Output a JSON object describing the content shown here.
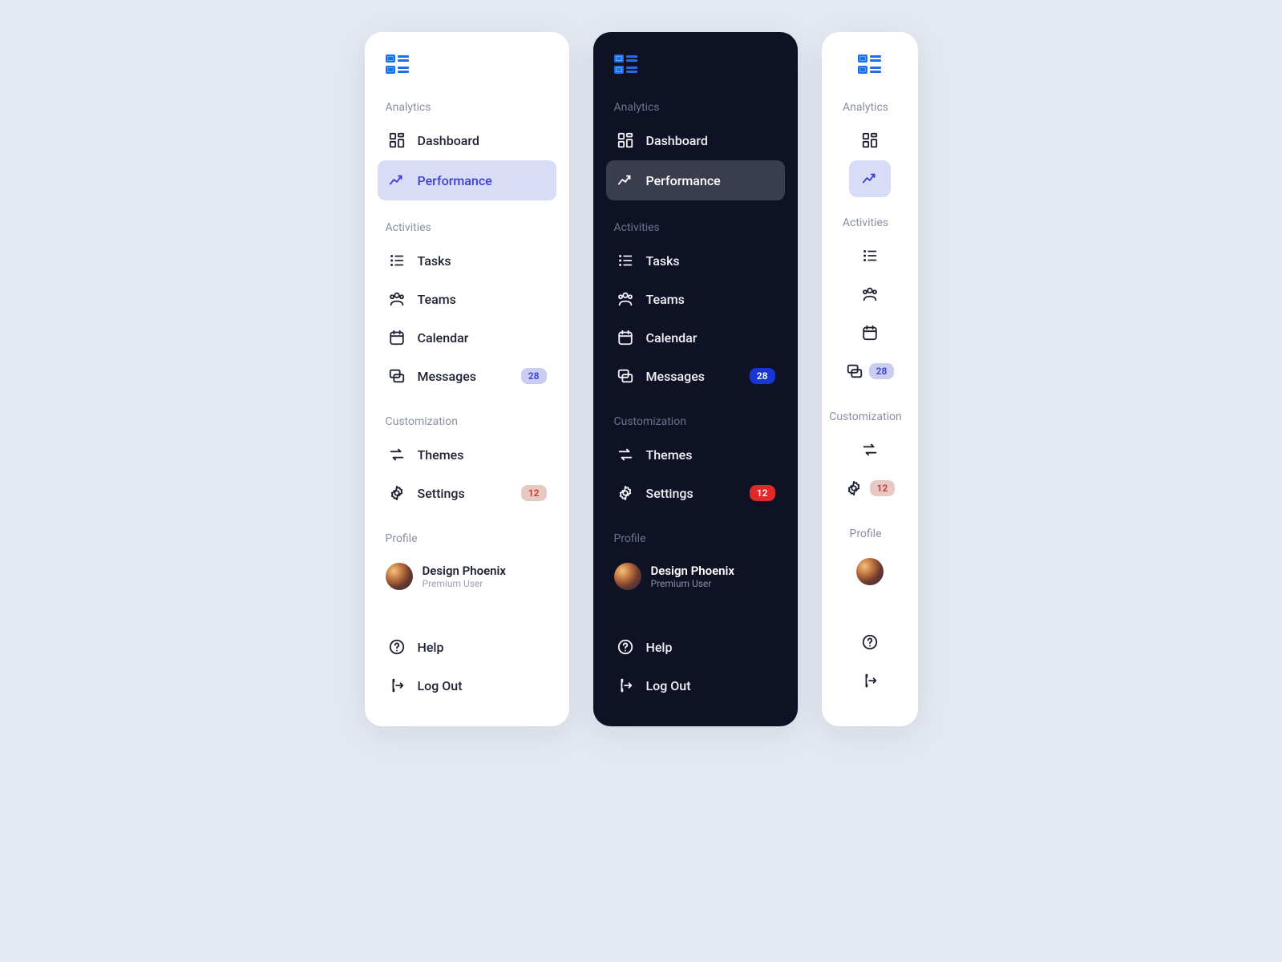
{
  "sections": {
    "analytics": "Analytics",
    "activities": "Activities",
    "customization": "Customization",
    "profile": "Profile"
  },
  "items": {
    "dashboard": "Dashboard",
    "performance": "Performance",
    "tasks": "Tasks",
    "teams": "Teams",
    "calendar": "Calendar",
    "messages": "Messages",
    "themes": "Themes",
    "settings": "Settings",
    "help": "Help",
    "logout": "Log Out"
  },
  "badges": {
    "messages": "28",
    "settings": "12"
  },
  "profile": {
    "name": "Design Phoenix",
    "sub": "Premium User"
  }
}
